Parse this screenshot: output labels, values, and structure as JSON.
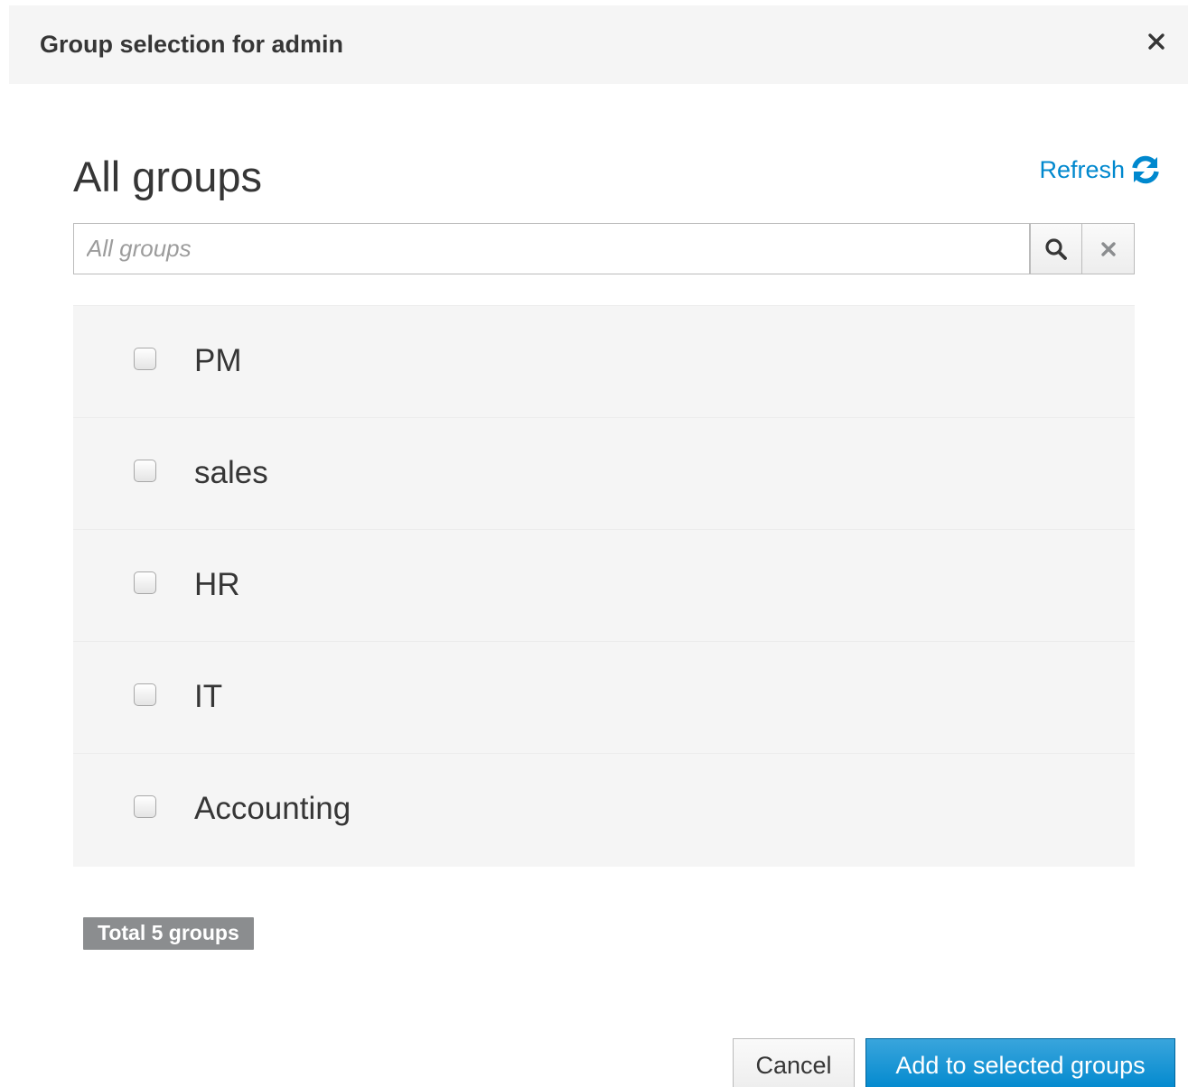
{
  "modal": {
    "title": "Group selection for admin",
    "close_icon": "close-icon"
  },
  "section": {
    "title": "All groups",
    "refresh_label": "Refresh",
    "refresh_icon": "refresh-icon"
  },
  "search": {
    "placeholder": "All groups",
    "value": "",
    "search_icon": "search-icon",
    "clear_icon": "clear-icon"
  },
  "groups": [
    {
      "name": "PM",
      "checked": false
    },
    {
      "name": "sales",
      "checked": false
    },
    {
      "name": "HR",
      "checked": false
    },
    {
      "name": "IT",
      "checked": false
    },
    {
      "name": "Accounting",
      "checked": false
    }
  ],
  "footer": {
    "total_label": "Total 5 groups",
    "cancel_label": "Cancel",
    "add_label": "Add to selected groups"
  },
  "colors": {
    "accent": "#0088ce",
    "header_bg": "#f5f5f5",
    "list_bg": "#f5f5f5",
    "badge_bg": "#8b8d8f",
    "text": "#363636"
  }
}
